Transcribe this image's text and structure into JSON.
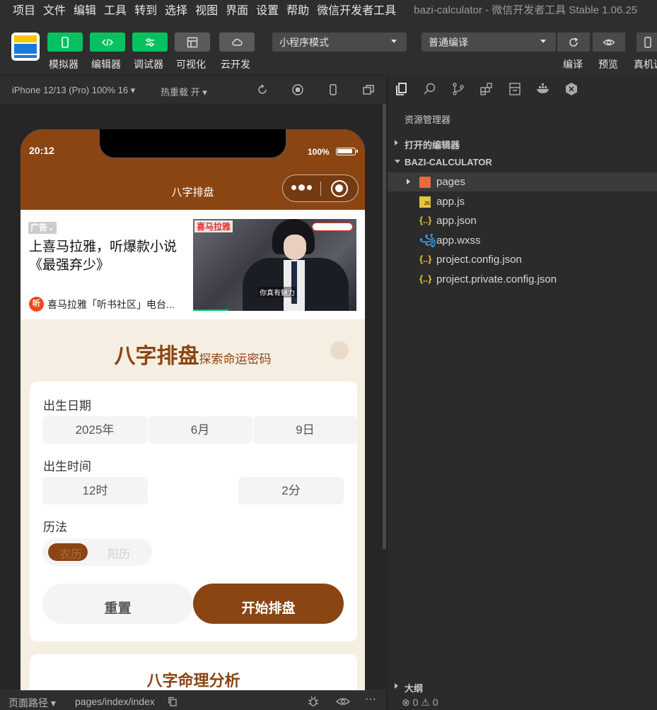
{
  "menubar": {
    "items": [
      "项目",
      "文件",
      "编辑",
      "工具",
      "转到",
      "选择",
      "视图",
      "界面",
      "设置",
      "帮助",
      "微信开发者工具"
    ],
    "title": "bazi-calculator - 微信开发者工具 Stable 1.06.25"
  },
  "toolbar": {
    "simulator": "模拟器",
    "editor": "编辑器",
    "debugger": "调试器",
    "visual": "可视化",
    "cloud": "云开发",
    "mode": "小程序模式",
    "compile_mode": "普通编译",
    "compile": "编译",
    "preview": "预览",
    "device": "真机调"
  },
  "simulator": {
    "device": "iPhone 12/13 (Pro) 100% 16 ▾",
    "hotreload": "热重载 开 ▾"
  },
  "phone": {
    "time": "20:12",
    "battery": "100%",
    "nav_title": "八字排盘",
    "ad": {
      "tag": "广告",
      "text": "上喜马拉雅，听爆款小说《最强弃少》",
      "source": "喜马拉雅「听书社区」电台...",
      "source_icon": "听",
      "brand": "喜马拉雅",
      "caption": "你真有魅力"
    },
    "page": {
      "title": "八字排盘",
      "subtitle": "探索命运密码",
      "birth_date_label": "出生日期",
      "year": "2025年",
      "month": "6月",
      "day": "9日",
      "birth_time_label": "出生时间",
      "hour": "12时",
      "minute": "2分",
      "calendar_label": "历法",
      "lunar": "农历",
      "solar": "阳历",
      "reset": "重置",
      "start": "开始排盘",
      "analysis_title": "八字命理分析"
    },
    "accent": "#8b4513"
  },
  "statusbar": {
    "path_label": "页面路径 ▾",
    "path": "pages/index/index"
  },
  "explorer": {
    "title": "资源管理器",
    "open_editors": "打开的编辑器",
    "project": "BAZI-CALCULATOR",
    "files": [
      "pages",
      "app.js",
      "app.json",
      "app.wxss",
      "project.config.json",
      "project.private.config.json"
    ],
    "outline": "大纲",
    "errors": "⊗ 0 ⚠ 0"
  }
}
